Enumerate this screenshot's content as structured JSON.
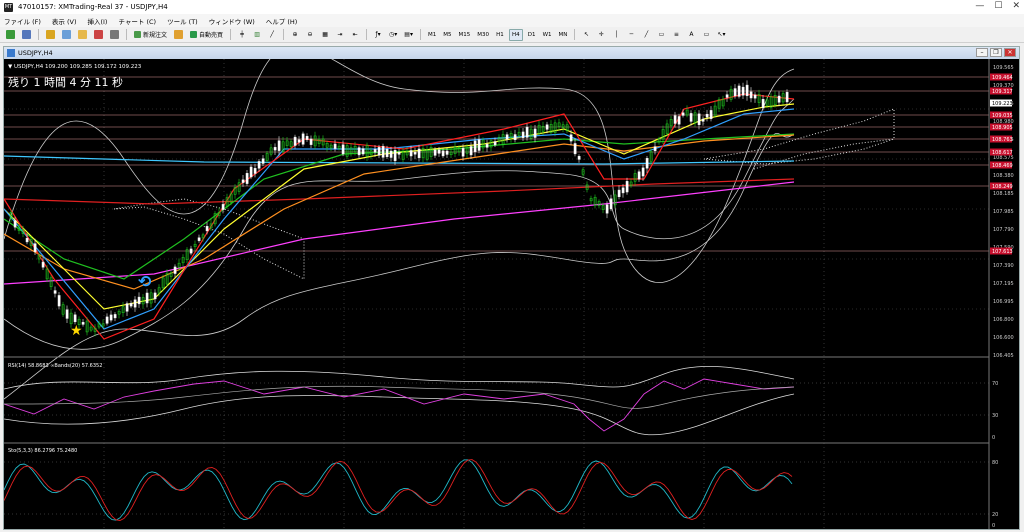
{
  "window": {
    "title": "47010157: XMTrading-Real 37 - USDJPY,H4",
    "app_icon": "mt4-icon"
  },
  "menu": [
    "ファイル (F)",
    "表示 (V)",
    "挿入(I)",
    "チャート (C)",
    "ツール (T)",
    "ウィンドウ (W)",
    "ヘルプ (H)"
  ],
  "toolbar": {
    "new_order": "新規注文",
    "auto_trade": "自動売買",
    "timeframes": [
      "M1",
      "M5",
      "M15",
      "M30",
      "H1",
      "H4",
      "D1",
      "W1",
      "MN"
    ],
    "text_tool": "A"
  },
  "chart": {
    "tab_title": "USDJPY,H4",
    "header": "▼ USDJPY,H4  109.200 109.285 109.172 109.223",
    "countdown": "残り 1 時間 4 分 11 秒",
    "price_labels": [
      "109.565",
      "109.370",
      "109.175",
      "108.980",
      "108.785",
      "108.575",
      "108.380",
      "108.185",
      "107.985",
      "107.790",
      "107.590",
      "107.390",
      "107.195",
      "106.995",
      "106.800",
      "106.600",
      "106.405"
    ],
    "highlight_labels": [
      {
        "text": "109.464",
        "color": "#c8102e"
      },
      {
        "text": "109.317",
        "color": "#c8102e"
      },
      {
        "text": "109.223",
        "color": "#ffffff"
      },
      {
        "text": "109.035",
        "color": "#c8102e"
      },
      {
        "text": "108.905",
        "color": "#c8102e"
      },
      {
        "text": "108.763",
        "color": "#c8102e"
      },
      {
        "text": "108.617",
        "color": "#c8102e"
      },
      {
        "text": "108.469",
        "color": "#c8102e"
      },
      {
        "text": "108.249",
        "color": "#c8102e"
      },
      {
        "text": "107.613",
        "color": "#c8102e"
      }
    ]
  },
  "rsi": {
    "header": "RSI(14) 58.8683  ∞Bands(20) 57.6352",
    "levels": [
      "100",
      "70",
      "30",
      "0"
    ]
  },
  "stoch": {
    "header": "Sto(5,3,3) 86.2796 75.2480",
    "levels": [
      "100",
      "80",
      "20",
      "0"
    ]
  }
}
